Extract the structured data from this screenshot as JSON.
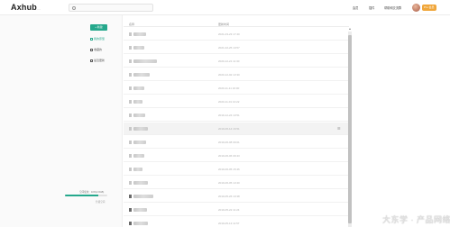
{
  "header": {
    "logo": "Axhub",
    "logo_sub": "——",
    "search_placeholder": "",
    "nav": [
      "会员",
      "插件",
      "帮助和交流群",
      ""
    ],
    "pro_badge": "Pro 会员"
  },
  "sidebar": {
    "new_button": "+ 新建",
    "items": [
      {
        "label": "我的原型",
        "icon": "file-icon",
        "active": true
      },
      {
        "label": "收藏的",
        "icon": "star-icon",
        "active": false
      },
      {
        "label": "最近更新",
        "icon": "clock-icon",
        "active": false
      }
    ],
    "quota_text": "空间使用：10%(2.0GB)",
    "quota_fraction": 0.78,
    "upgrade_label": "升级空间"
  },
  "list": {
    "col_name": "名称",
    "col_date": "更新时间",
    "rows": [
      {
        "date": "2021-03-23 17:40",
        "w": 14,
        "dark": false
      },
      {
        "date": "2021-02-25 10:57",
        "w": 12,
        "dark": false
      },
      {
        "date": "2020-12-21 11:30",
        "w": 26,
        "dark": false
      },
      {
        "date": "2020-12-02 13:30",
        "w": 18,
        "dark": false
      },
      {
        "date": "2020-11-11 16:00",
        "w": 12,
        "dark": false
      },
      {
        "date": "2020-11-01 10:22",
        "w": 10,
        "dark": false
      },
      {
        "date": "2019-12-24 10:51",
        "w": 13,
        "dark": false
      },
      {
        "date": "2019-06-14 16:51",
        "w": 16,
        "dark": false,
        "highlight": true,
        "menu": "☰"
      },
      {
        "date": "2019-06-08 09:01",
        "w": 14,
        "dark": false
      },
      {
        "date": "2019-06-06 09:43",
        "w": 12,
        "dark": false
      },
      {
        "date": "2019-06-05 15:46",
        "w": 10,
        "dark": false
      },
      {
        "date": "2019-06-05 13:40",
        "w": 16,
        "dark": false
      },
      {
        "date": "2019-05-26 10:38",
        "w": 22,
        "dark": true
      },
      {
        "date": "2019-05-22 11:24",
        "w": 15,
        "dark": true
      },
      {
        "date": "2019-05-13 11:57",
        "w": 16,
        "dark": true
      }
    ]
  },
  "watermark": "大东学 · 产品网络",
  "colors": {
    "accent": "#25a88c",
    "badge": "#f0a63a"
  }
}
